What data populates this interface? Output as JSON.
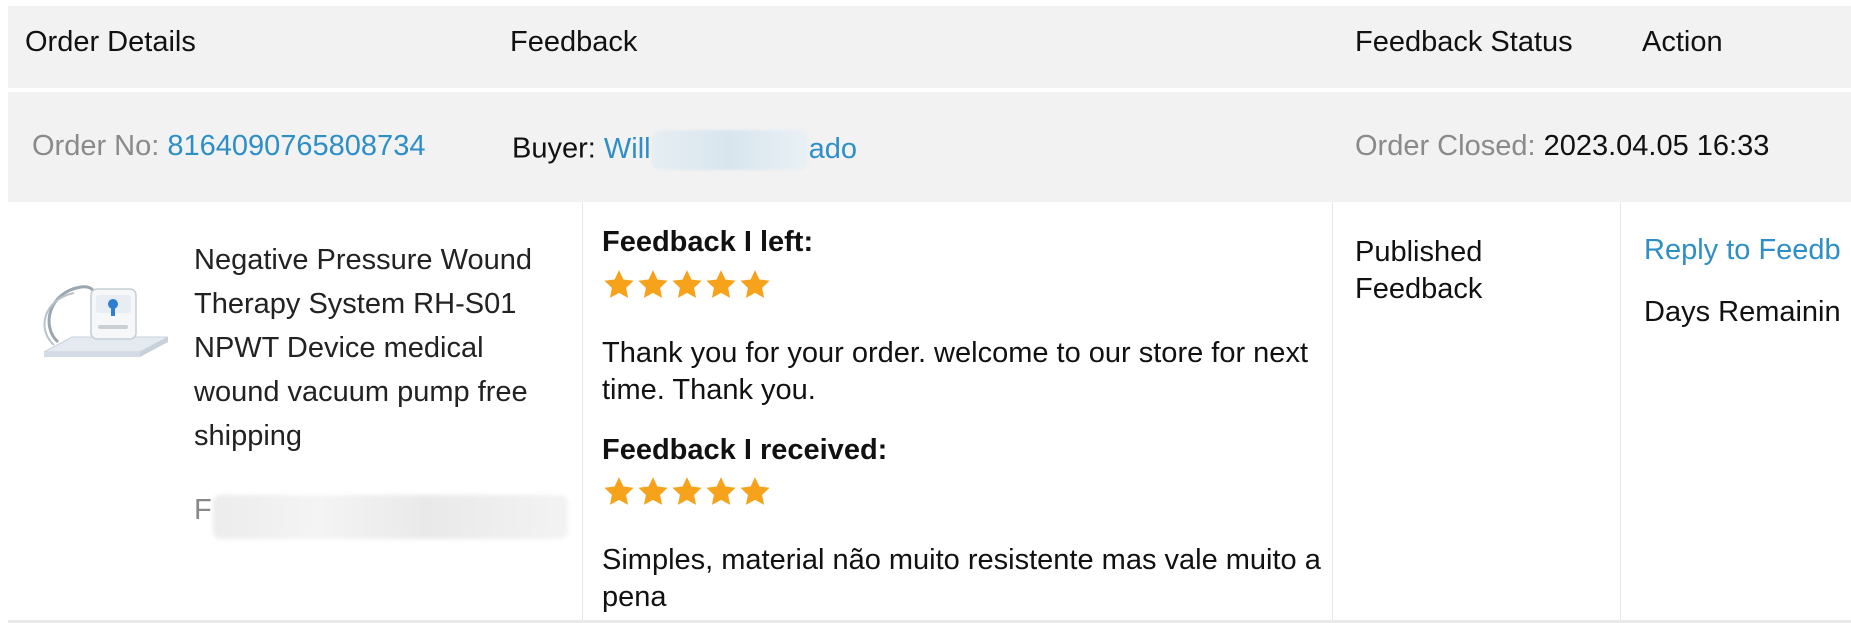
{
  "header": {
    "order_details": "Order Details",
    "feedback": "Feedback",
    "feedback_status": "Feedback Status",
    "action": "Action"
  },
  "order": {
    "order_no_label": "Order No:",
    "order_no": "8164090765808734",
    "buyer_label": "Buyer:",
    "buyer_name_start": "Will",
    "buyer_name_end": "ado",
    "closed_label": "Order Closed:",
    "closed_date": "2023.04.05 16:33"
  },
  "product": {
    "title": "Negative Pressure Wound Therapy System RH-S01 NPWT Device medical wound vacuum pump free shipping",
    "extra_prefix": "F",
    "thumb_icon": "npwt-device-image"
  },
  "feedback": {
    "left_heading": "Feedback I left:",
    "left_rating": 5,
    "left_text": "Thank you for your order. welcome to our store for next time. Thank you.",
    "received_heading": "Feedback I received:",
    "received_rating": 5,
    "received_text": "Simples, material não muito resistente mas vale muito a pena",
    "star_color": "#f7a21b"
  },
  "status": {
    "text": "Published Feedback"
  },
  "action": {
    "reply_label": "Reply to Feedb",
    "days_remaining_label": "Days Remainin"
  },
  "colors": {
    "header_bg": "#f2f2f2",
    "link": "#2e8fc7",
    "muted": "#8a8a8a"
  }
}
